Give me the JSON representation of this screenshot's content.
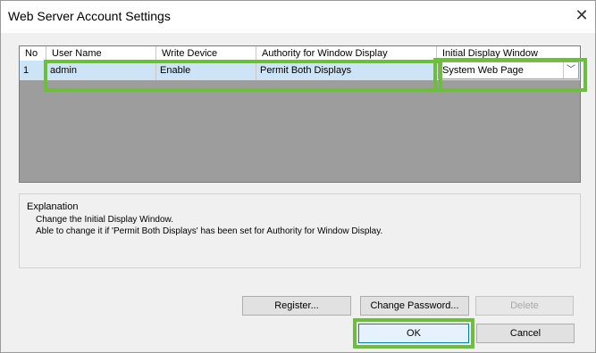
{
  "window": {
    "title": "Web Server Account Settings",
    "close_symbol": "✕"
  },
  "grid": {
    "columns": [
      "No",
      "User Name",
      "Write Device",
      "Authority for Window Display",
      "Initial Display Window"
    ],
    "rows": [
      {
        "no": "1",
        "user_name": "admin",
        "write_device": "Enable",
        "authority": "Permit Both Displays",
        "initial_window": "System Web Page"
      }
    ],
    "dropdown_arrow": "﹀"
  },
  "explanation": {
    "title": "Explanation",
    "lines": [
      "Change the Initial Display Window.",
      "Able to change it if 'Permit Both Displays' has been set for Authority for Window Display."
    ]
  },
  "buttons": {
    "register": "Register...",
    "change_password": "Change Password...",
    "delete": "Delete",
    "ok": "OK",
    "cancel": "Cancel"
  },
  "colors": {
    "highlight": "#6bbf3c",
    "selected_row": "#cde4f7",
    "grid_empty": "#9d9d9d"
  }
}
